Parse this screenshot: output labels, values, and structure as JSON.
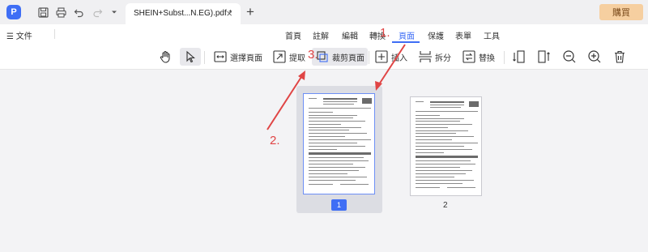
{
  "titlebar": {
    "logo": "P",
    "tab_title": "SHEIN+Subst...N.EG).pdf *",
    "close": "×",
    "new_tab": "+",
    "buy_label": "購買",
    "icons": [
      "save-icon",
      "print-icon",
      "undo-icon",
      "redo-icon",
      "dropdown-icon"
    ]
  },
  "menubar": {
    "file_label": "☰ 文件",
    "items": [
      "首頁",
      "註解",
      "編輯",
      "轉換",
      "頁面",
      "保護",
      "表單",
      "工具"
    ],
    "active": "頁面"
  },
  "toolbar": {
    "select_page": "選擇頁面",
    "extract": "提取",
    "crop": "裁剪頁面",
    "insert": "插入",
    "split": "拆分",
    "replace": "替換"
  },
  "pages": [
    {
      "number": "1",
      "selected": true
    },
    {
      "number": "2",
      "selected": false
    }
  ],
  "annotations": {
    "step1": "1.",
    "step2": "2.",
    "step3": "3.",
    "color": "#e04545"
  },
  "colors": {
    "accent": "#3f6ef5",
    "buy_button": "#f6cfa0"
  }
}
